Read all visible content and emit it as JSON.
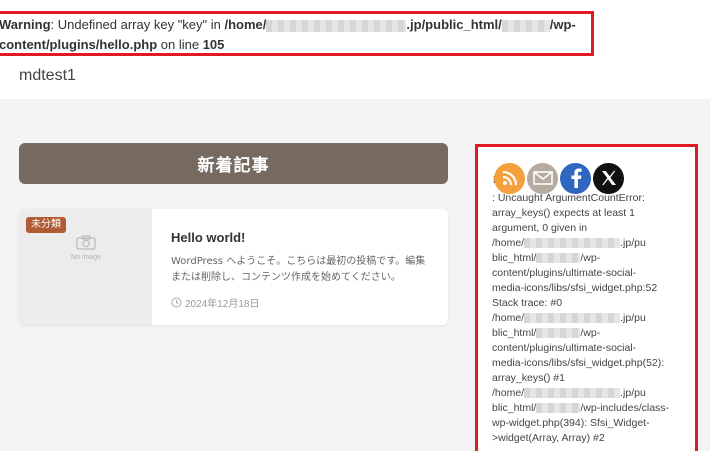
{
  "warning": {
    "label": "Warning",
    "msg_part1": ": Undefined array key \"key\" in ",
    "path_part1": "/home/",
    "path_part2": ".jp/public_html/",
    "path_part3": "/wp-",
    "path_part4": "content/plugins/hello.php",
    "on_line": " on line ",
    "line_number": "105"
  },
  "site": {
    "title": "mdtest1"
  },
  "main": {
    "section_heading": "新着記事",
    "post": {
      "category": "未分類",
      "noimage_text": "No image",
      "title": "Hello world!",
      "excerpt": "WordPress へようこそ。こちらは最初の投稿です。編集または削除し、コンテンツ作成を始めてください。",
      "date": "2024年12月18日"
    }
  },
  "sidebar": {
    "social_prefix": "F",
    "social_icons": [
      "rss-icon",
      "mail-icon",
      "facebook-icon",
      "x-icon"
    ],
    "error_lines": [
      ": Uncaught ArgumentCountError:",
      "array_keys() expects at least 1",
      "argument, 0 given in",
      "/home/[masked].jp/pu",
      "blic_html/[masked]/wp-",
      "content/plugins/ultimate-social-",
      "media-icons/libs/sfsi_widget.php:52",
      "Stack trace: #0",
      "/home/[masked].jp/pu",
      "blic_html/[masked]/wp-",
      "content/plugins/ultimate-social-",
      "media-icons/libs/sfsi_widget.php(52):",
      "array_keys() #1",
      "/home/[masked].jp/pu",
      "blic_html/[masked]/wp-includes/class-",
      "wp-widget.php(394): Sfsi_Widget-",
      ">widget(Array, Array) #2"
    ]
  },
  "colors": {
    "highlight_border": "#e01a22",
    "section_heading_bg": "#766a60",
    "category_badge_bg": "#b05b33"
  }
}
